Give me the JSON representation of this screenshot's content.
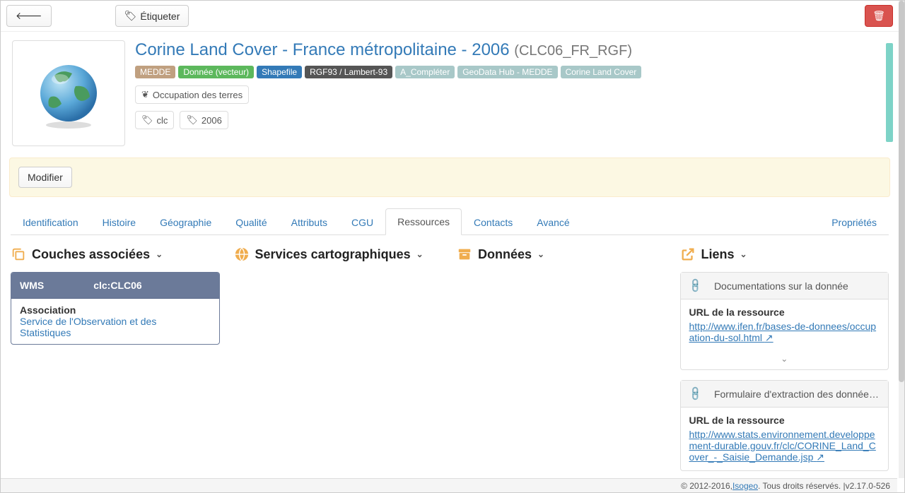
{
  "toolbar": {
    "etiqueter": "Étiqueter"
  },
  "title": {
    "main": "Corine Land Cover - France métropolitaine - 2006",
    "code": "(CLC06_FR_RGF)"
  },
  "badges": [
    {
      "label": "MEDDE",
      "bg": "#c0a080"
    },
    {
      "label": "Donnée (vecteur)",
      "bg": "#5cb85c"
    },
    {
      "label": "Shapefile",
      "bg": "#337ab7"
    },
    {
      "label": "RGF93 / Lambert-93",
      "bg": "#555"
    },
    {
      "label": "A_Compléter",
      "bg": "#a8c8c8"
    },
    {
      "label": "GeoData Hub - MEDDE",
      "bg": "#a8c8c8"
    },
    {
      "label": "Corine Land Cover",
      "bg": "#a8c8c8"
    }
  ],
  "theme": {
    "label": "Occupation des terres"
  },
  "tags": [
    {
      "label": "clc"
    },
    {
      "label": "2006"
    }
  ],
  "alert": {
    "modify": "Modifier"
  },
  "tabs": {
    "identification": "Identification",
    "histoire": "Histoire",
    "geographie": "Géographie",
    "qualite": "Qualité",
    "attributs": "Attributs",
    "cgu": "CGU",
    "ressources": "Ressources",
    "contacts": "Contacts",
    "avance": "Avancé",
    "proprietes": "Propriétés"
  },
  "sections": {
    "couches": "Couches associées",
    "services": "Services cartographiques",
    "donnees": "Données",
    "liens": "Liens"
  },
  "layer": {
    "type": "WMS",
    "name": "clc:CLC06",
    "assoc_label": "Association",
    "assoc_value": "Service de l'Observation et des Statistiques"
  },
  "link1": {
    "title": "Documentations sur la donnée",
    "url_label": "URL de la ressource",
    "url": "http://www.ifen.fr/bases-de-donnees/occupation-du-sol.html"
  },
  "link2": {
    "title": "Formulaire d'extraction des données d...",
    "url_label": "URL de la ressource",
    "url": "http://www.stats.environnement.developpement-durable.gouv.fr/clc/CORINE_Land_Cover_-_Saisie_Demande.jsp"
  },
  "footer": {
    "copyright": "© 2012-2016, ",
    "brand": "Isogeo",
    "rights": ". Tous droits réservés. | ",
    "version": "v2.17.0-526"
  }
}
